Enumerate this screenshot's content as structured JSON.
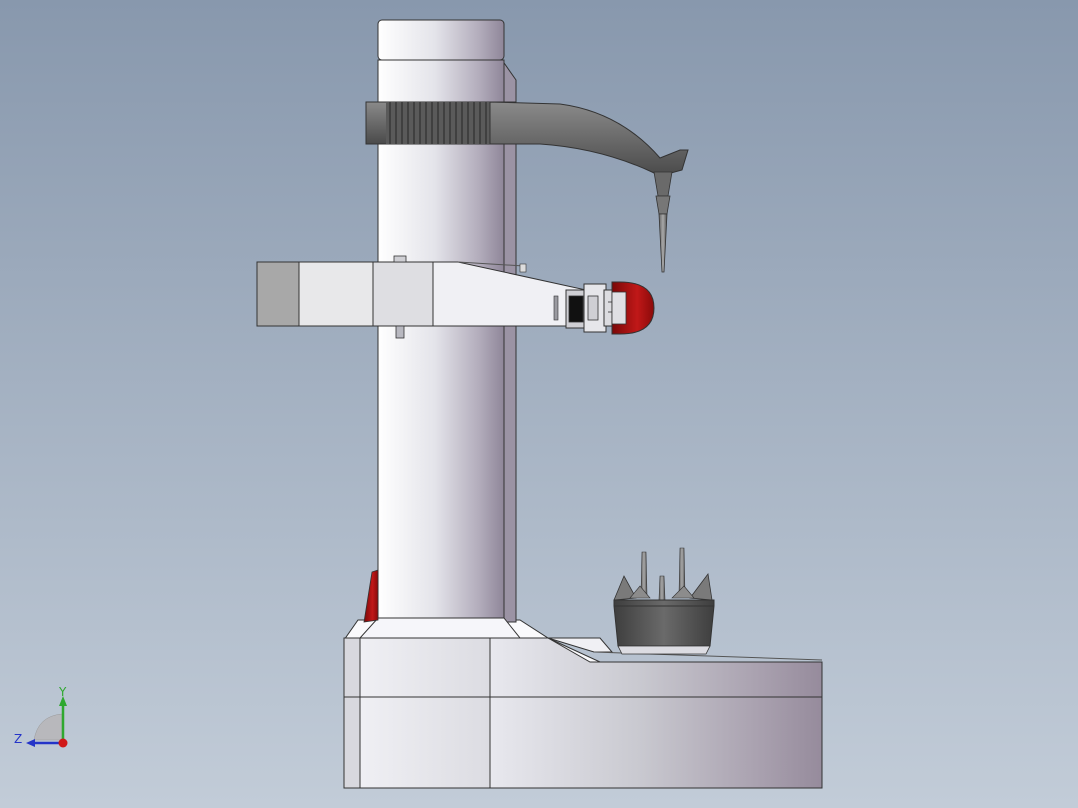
{
  "viewport": {
    "background_top": "#8898ad",
    "background_bottom": "#c2ccd8"
  },
  "model": {
    "body_color": "#e6e6ea",
    "shadow_color": "#8f8699",
    "arm_dark_color": "#6b6b6b",
    "accent_red": "#b01010",
    "chuck_color": "#555555"
  },
  "triad": {
    "y_label": "Y",
    "z_label": "Z",
    "y_color": "#2fa82f",
    "z_color": "#2434c8",
    "x_color": "#d01818"
  }
}
